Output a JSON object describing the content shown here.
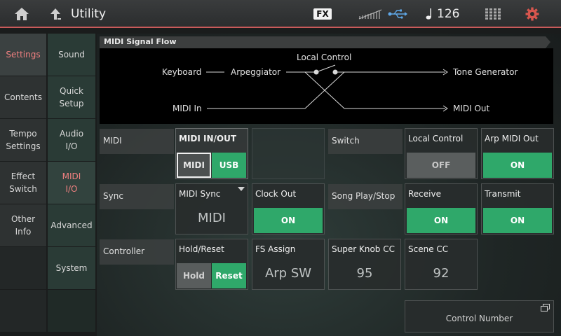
{
  "header": {
    "title": "Utility",
    "fx_badge": "FX",
    "tempo": "126",
    "icons": [
      "home-icon",
      "up-arrow-icon",
      "midi-level-icon",
      "usb-icon",
      "quarter-note-icon",
      "grid-icon",
      "gear-icon"
    ],
    "accent_color": "#c85a5a"
  },
  "sidebar": {
    "primary": [
      {
        "label": "Settings",
        "active": true
      },
      {
        "label": "Contents",
        "active": false
      },
      {
        "label": "Tempo\nSettings",
        "active": false
      },
      {
        "label": "Effect\nSwitch",
        "active": false
      },
      {
        "label": "Other\nInfo",
        "active": false
      }
    ],
    "secondary": [
      {
        "label": "Sound",
        "active": false
      },
      {
        "label": "Quick\nSetup",
        "active": false
      },
      {
        "label": "Audio\nI/O",
        "active": false
      },
      {
        "label": "MIDI\nI/O",
        "active": true
      },
      {
        "label": "Advanced",
        "active": false
      },
      {
        "label": "System",
        "active": false
      }
    ]
  },
  "signal_flow": {
    "title": "MIDI Signal Flow",
    "keyboard": "Keyboard",
    "arpeggiator": "Arpeggiator",
    "local_control": "Local Control",
    "tone_generator": "Tone Generator",
    "midi_in": "MIDI In",
    "midi_out": "MIDI Out"
  },
  "rows": {
    "midi": {
      "label": "MIDI",
      "midi_in_out": {
        "label": "MIDI IN/OUT",
        "options": [
          "MIDI",
          "USB"
        ],
        "selected": "USB"
      },
      "switch_label": "Switch",
      "local_control": {
        "label": "Local Control",
        "value": "OFF"
      },
      "arp_midi_out": {
        "label": "Arp MIDI Out",
        "value": "ON"
      }
    },
    "sync": {
      "label": "Sync",
      "midi_sync": {
        "label": "MIDI Sync",
        "value": "MIDI"
      },
      "clock_out": {
        "label": "Clock Out",
        "value": "ON"
      },
      "song_play_stop": {
        "label": "Song Play/Stop"
      },
      "receive": {
        "label": "Receive",
        "value": "ON"
      },
      "transmit": {
        "label": "Transmit",
        "value": "ON"
      }
    },
    "controller": {
      "label": "Controller",
      "hold_reset": {
        "label": "Hold/Reset",
        "options": [
          "Hold",
          "Reset"
        ],
        "selected": "Reset"
      },
      "fs_assign": {
        "label": "FS Assign",
        "value": "Arp SW"
      },
      "super_knob_cc": {
        "label": "Super Knob CC",
        "value": "95"
      },
      "scene_cc": {
        "label": "Scene CC",
        "value": "92"
      }
    },
    "control_number": {
      "label": "Control Number"
    }
  },
  "colors": {
    "on": "#2fa86a",
    "off": "#5a5e5e",
    "active_tab": "#f08080"
  }
}
